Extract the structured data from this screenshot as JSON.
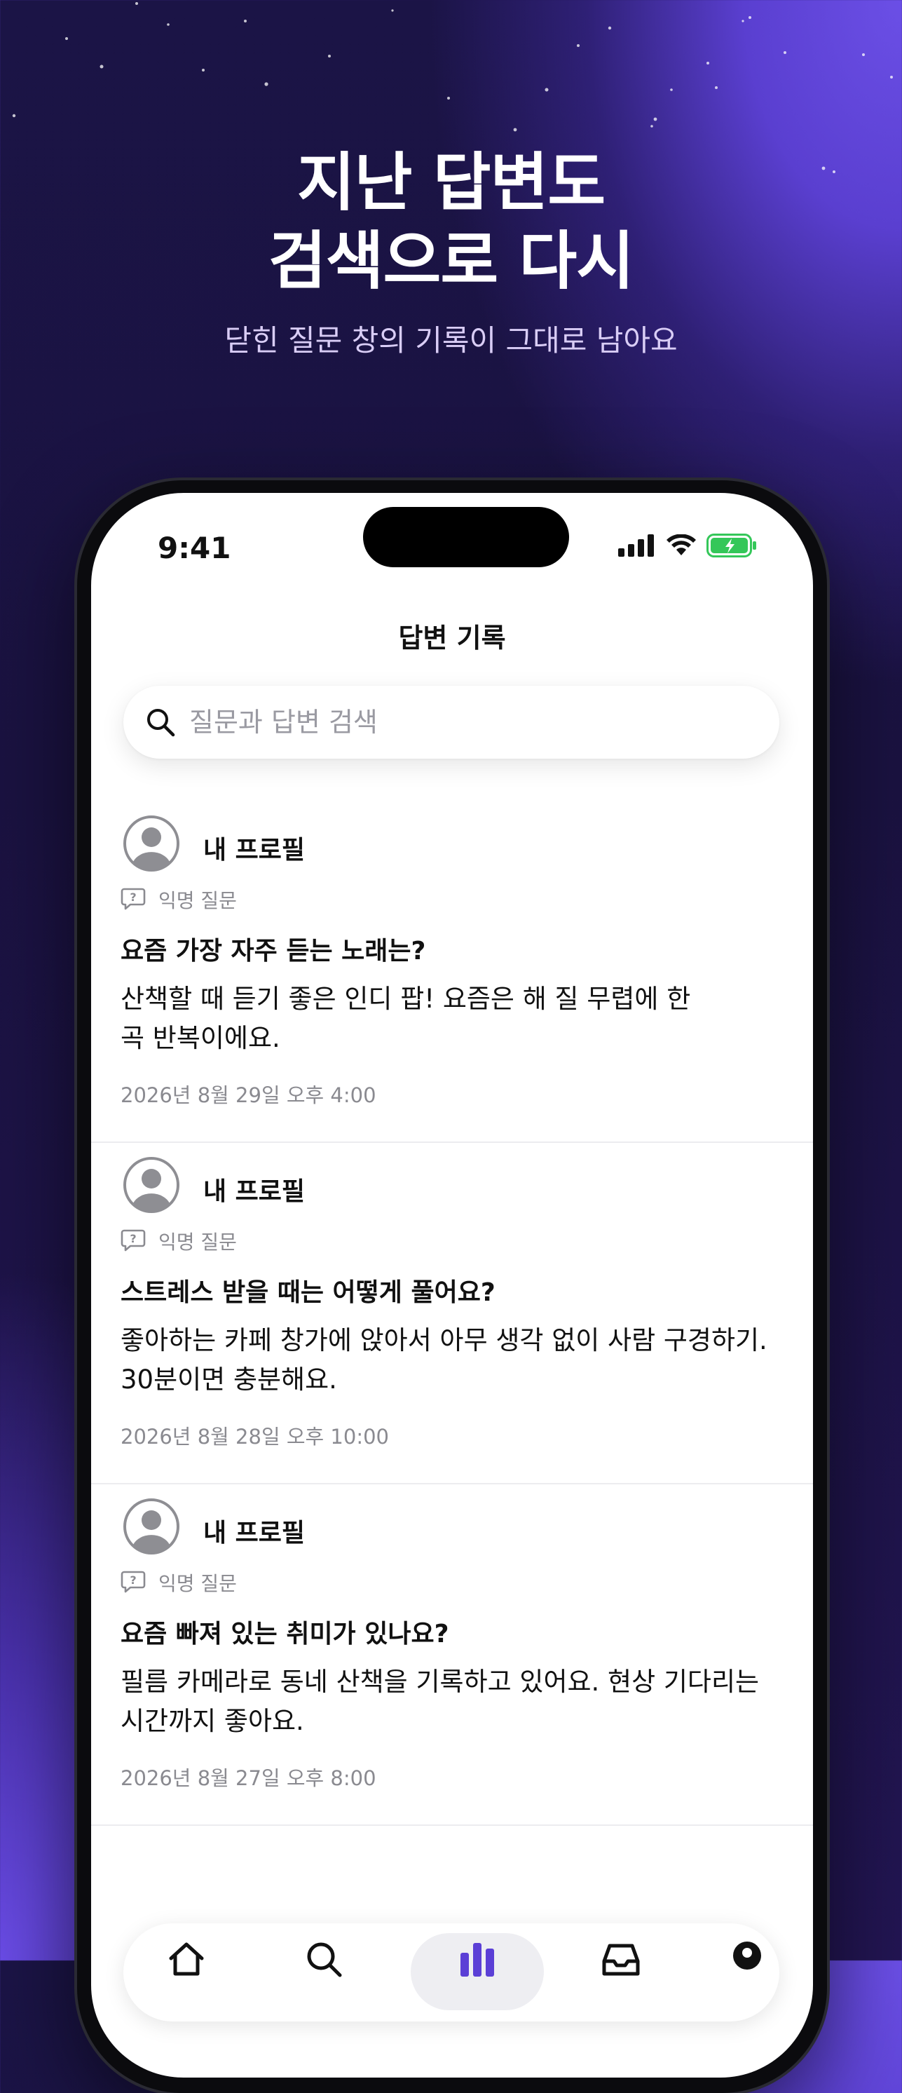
{
  "hero": {
    "title_line1": "지난 답변도",
    "title_line2": "검색으로 다시",
    "subtitle": "닫힌 질문 창의 기록이 그대로 남아요"
  },
  "status_bar": {
    "time": "9:41"
  },
  "nav": {
    "title": "답변 기록"
  },
  "search": {
    "placeholder": "질문과 답변 검색"
  },
  "cards": [
    {
      "profile_name": "내 프로필",
      "question_type": "익명 질문",
      "question": "요즘 가장 자주 듣는 노래는?",
      "answer": "산책할 때 듣기 좋은 인디 팝! 요즘은 해 질 무렵에 한 곡 반복이에요.",
      "date": "2026년 8월 29일 오후 4:00"
    },
    {
      "profile_name": "내 프로필",
      "question_type": "익명 질문",
      "question": "스트레스 받을 때는 어떻게 풀어요?",
      "answer": "좋아하는 카페 창가에 앉아서 아무 생각 없이 사람 구경하기. 30분이면 충분해요.",
      "date": "2026년 8월 28일 오후 10:00"
    },
    {
      "profile_name": "내 프로필",
      "question_type": "익명 질문",
      "question": "요즘 빠져 있는 취미가 있나요?",
      "answer": "필름 카메라로 동네 산책을 기록하고 있어요. 현상 기다리는 시간까지 좋아요.",
      "date": "2026년 8월 27일 오후 8:00"
    }
  ],
  "tab_bar": {
    "tabs": [
      {
        "icon": "home-icon"
      },
      {
        "icon": "search-icon"
      },
      {
        "icon": "stats-icon",
        "active": true
      },
      {
        "icon": "inbox-icon"
      },
      {
        "icon": "profile-icon"
      }
    ]
  },
  "colors": {
    "accent": "#5b3fd6",
    "background_dark": "#1a1240",
    "battery": "#34c759"
  }
}
